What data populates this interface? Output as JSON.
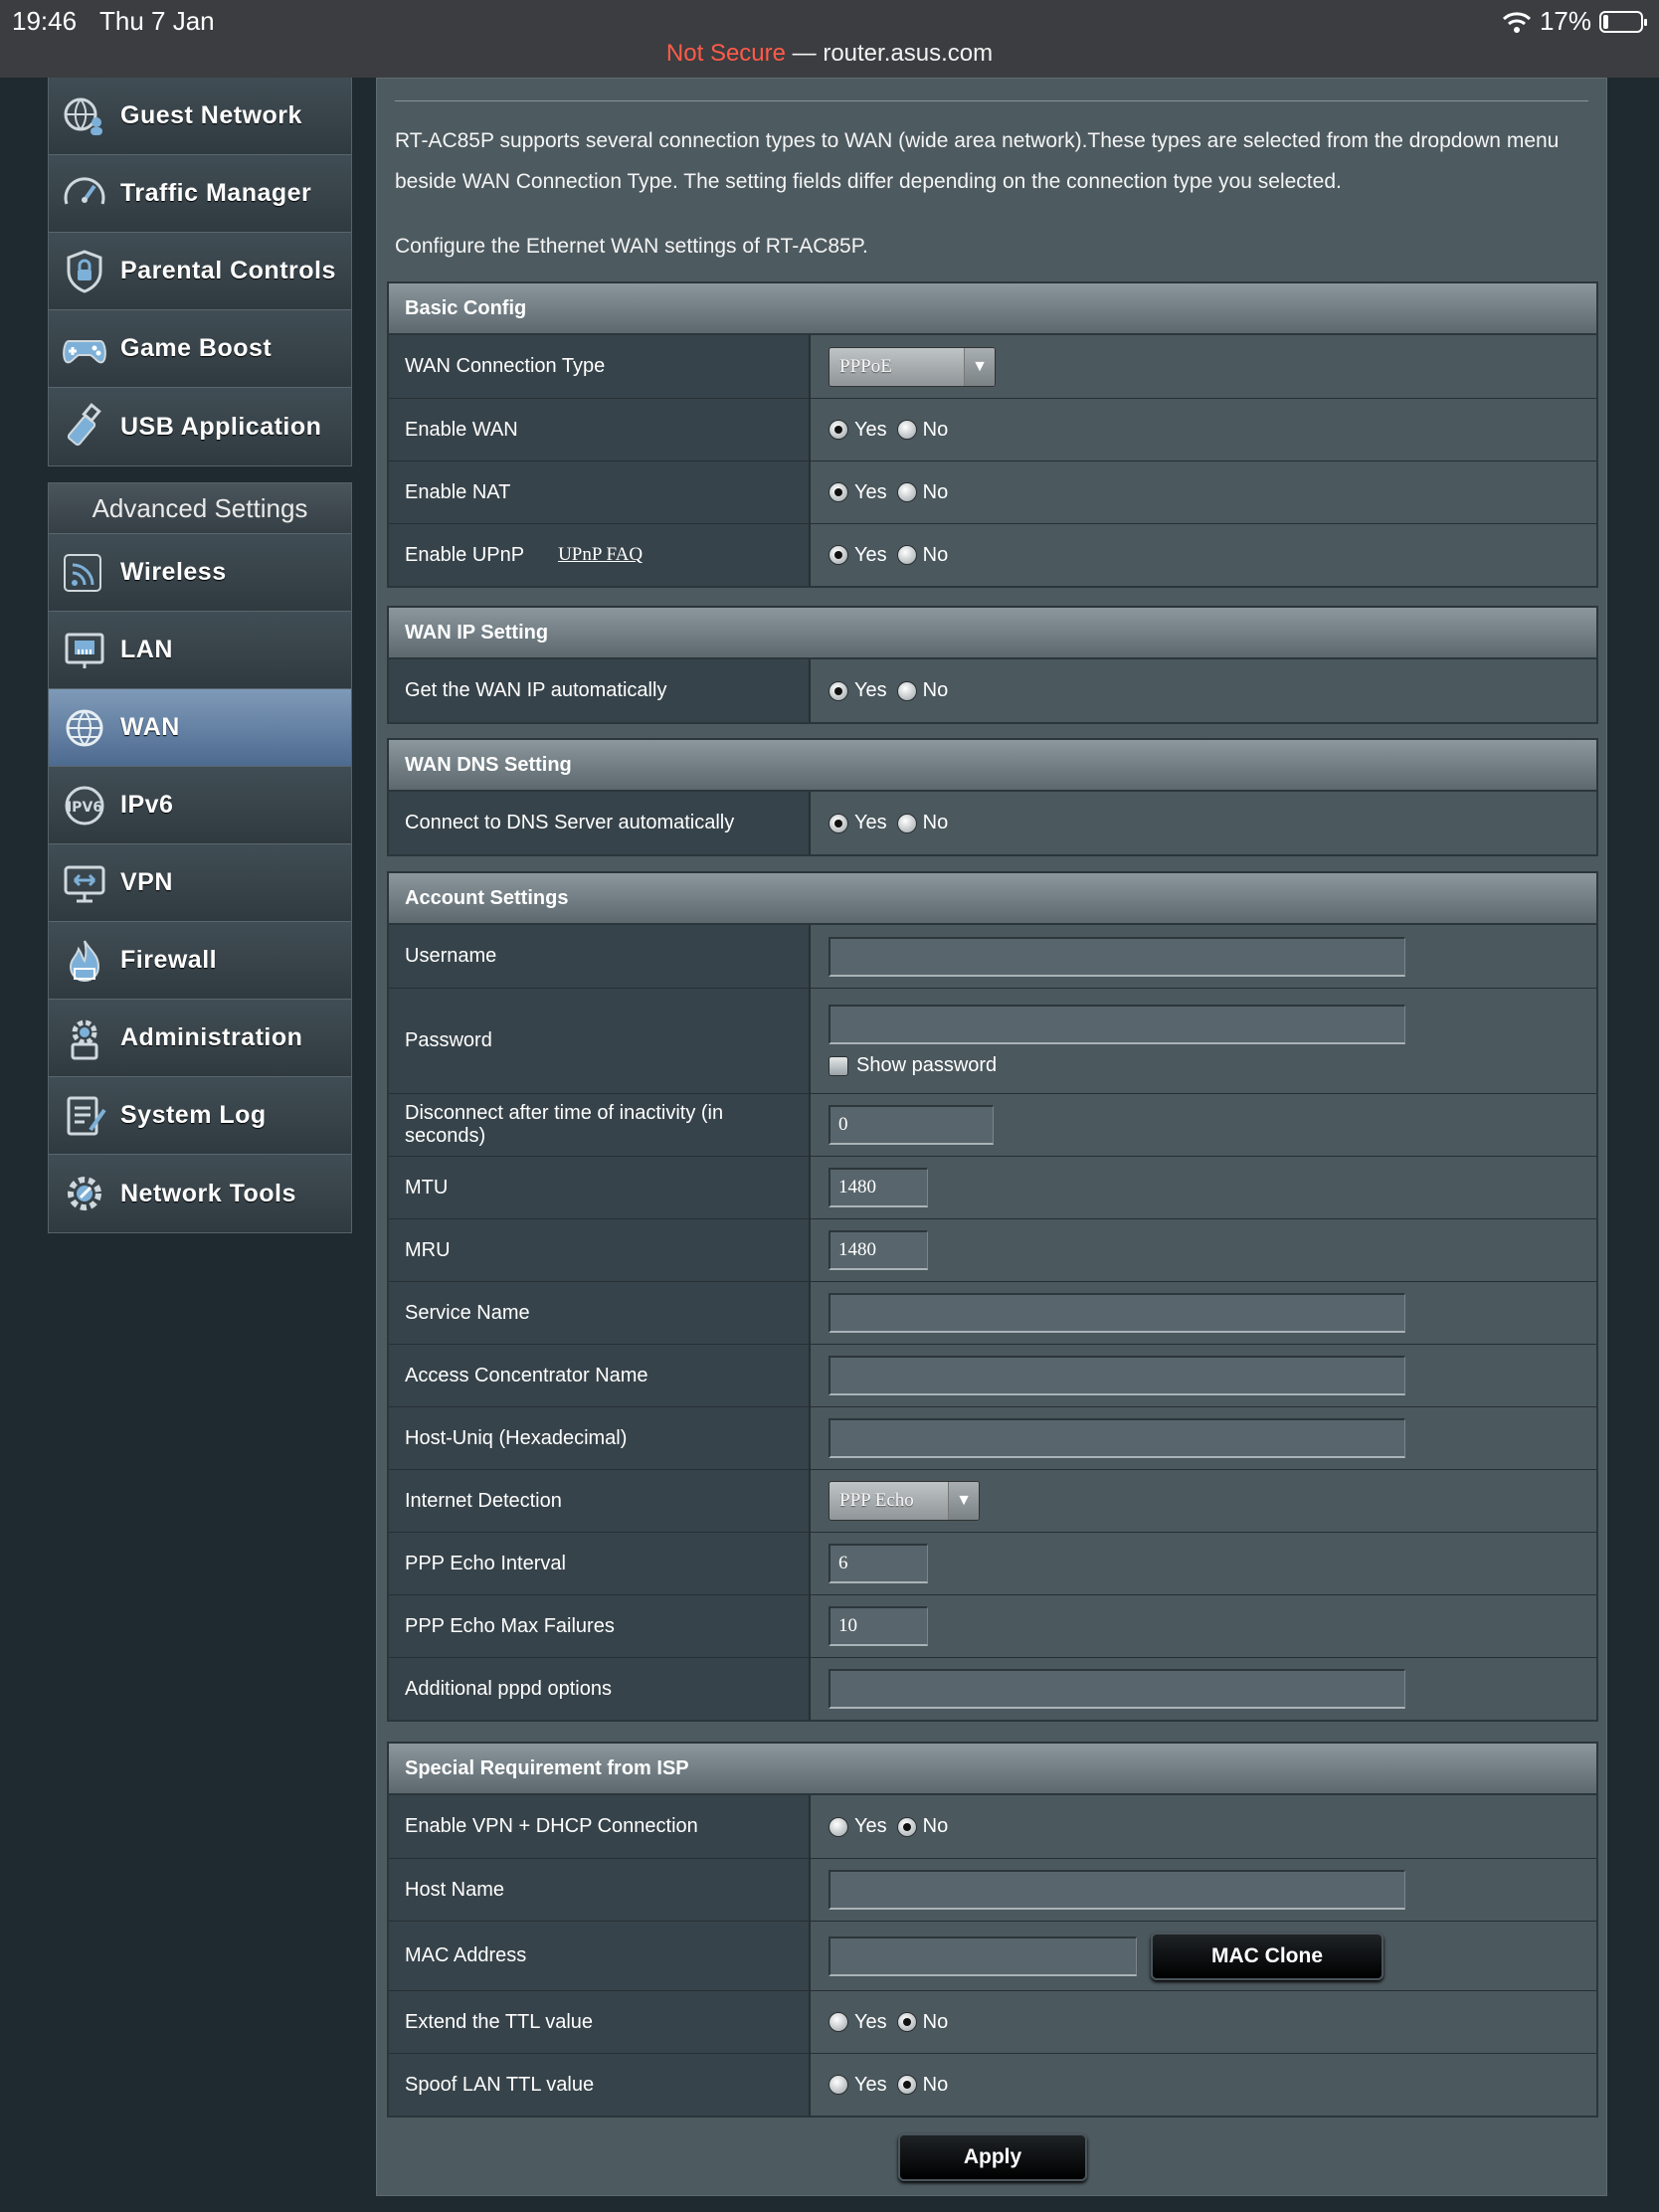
{
  "status_bar": {
    "time": "19:46",
    "date": "Thu 7 Jan",
    "battery": "17%"
  },
  "browser": {
    "insecure_label": "Not Secure",
    "separator": " — ",
    "domain": "router.asus.com"
  },
  "sidebar": {
    "general_items": [
      {
        "label": "Guest Network",
        "icon": "globe-people-icon"
      },
      {
        "label": "Traffic Manager",
        "icon": "speedometer-icon"
      },
      {
        "label": "Parental Controls",
        "icon": "shield-lock-icon"
      },
      {
        "label": "Game Boost",
        "icon": "gamepad-icon"
      },
      {
        "label": "USB Application",
        "icon": "usb-icon"
      }
    ],
    "advanced_title": "Advanced Settings",
    "advanced_items": [
      {
        "label": "Wireless",
        "icon": "wifi-icon"
      },
      {
        "label": "LAN",
        "icon": "lan-icon"
      },
      {
        "label": "WAN",
        "icon": "globe-icon",
        "active": true
      },
      {
        "label": "IPv6",
        "icon": "ipv6-icon"
      },
      {
        "label": "VPN",
        "icon": "vpn-icon"
      },
      {
        "label": "Firewall",
        "icon": "fire-icon"
      },
      {
        "label": "Administration",
        "icon": "admin-gear-icon"
      },
      {
        "label": "System Log",
        "icon": "syslog-icon"
      },
      {
        "label": "Network Tools",
        "icon": "network-tools-icon"
      }
    ]
  },
  "main": {
    "description": "RT-AC85P supports several connection types to WAN (wide area network).These types are selected from the dropdown menu beside WAN Connection Type. The setting fields differ depending on the connection type you selected.",
    "configure_text": "Configure the Ethernet WAN settings of RT-AC85P.",
    "radio_yes": "Yes",
    "radio_no": "No",
    "apply_label": "Apply"
  },
  "basic_config": {
    "title": "Basic Config",
    "wan_connection_type_label": "WAN Connection Type",
    "wan_connection_type_value": "PPPoE",
    "enable_wan_label": "Enable WAN",
    "enable_wan": "Yes",
    "enable_nat_label": "Enable NAT",
    "enable_nat": "Yes",
    "enable_upnp_label": "Enable UPnP",
    "upnp_faq_link": "UPnP FAQ",
    "enable_upnp": "Yes"
  },
  "wan_ip": {
    "title": "WAN IP Setting",
    "auto_label": "Get the WAN IP automatically",
    "auto": "Yes"
  },
  "wan_dns": {
    "title": "WAN DNS Setting",
    "auto_label": "Connect to DNS Server automatically",
    "auto": "Yes"
  },
  "account": {
    "title": "Account Settings",
    "username_label": "Username",
    "username_value": "",
    "password_label": "Password",
    "password_value": "",
    "show_password_label": "Show password",
    "idle_label": "Disconnect after time of inactivity (in seconds)",
    "idle_value": "0",
    "mtu_label": "MTU",
    "mtu_value": "1480",
    "mru_label": "MRU",
    "mru_value": "1480",
    "service_name_label": "Service Name",
    "service_name_value": "",
    "ac_name_label": "Access Concentrator Name",
    "ac_name_value": "",
    "host_uniq_label": "Host-Uniq (Hexadecimal)",
    "host_uniq_value": "",
    "internet_detection_label": "Internet Detection",
    "internet_detection_value": "PPP Echo",
    "echo_interval_label": "PPP Echo Interval",
    "echo_interval_value": "6",
    "echo_max_failures_label": "PPP Echo Max Failures",
    "echo_max_failures_value": "10",
    "pppd_options_label": "Additional pppd options",
    "pppd_options_value": ""
  },
  "isp": {
    "title": "Special Requirement from ISP",
    "vpn_dhcp_label": "Enable VPN + DHCP Connection",
    "vpn_dhcp": "No",
    "host_name_label": "Host Name",
    "host_name_value": "",
    "mac_label": "MAC Address",
    "mac_value": "",
    "mac_clone_label": "MAC Clone",
    "extend_ttl_label": "Extend the TTL value",
    "extend_ttl": "No",
    "spoof_ttl_label": "Spoof LAN TTL value",
    "spoof_ttl": "No"
  }
}
